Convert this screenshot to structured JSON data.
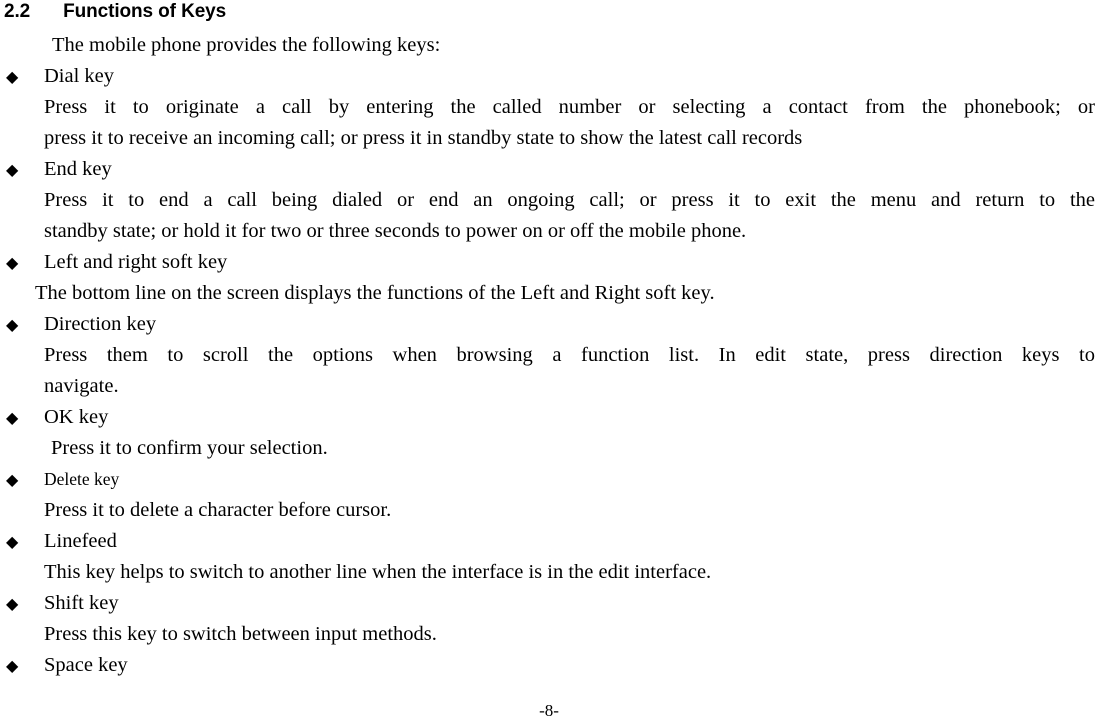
{
  "document": {
    "section_number": "2.2",
    "section_title": "Functions of Keys",
    "intro": "The mobile phone provides the following keys:",
    "bullet_glyph": "◆",
    "page_number": "-8-"
  },
  "items": [
    {
      "label": "Dial key",
      "paragraph_lines": [
        "Press it to originate a call by entering the called number or selecting a contact from the phonebook; or",
        "press it to receive an incoming call; or press it in standby state to show the latest call records"
      ]
    },
    {
      "label": "End key",
      "paragraph_lines": [
        "Press it to end a call being dialed or end an ongoing call; or press it to exit the menu and return to the",
        "standby state; or hold it for two or three seconds to power on or off the mobile phone."
      ]
    },
    {
      "label": "Left and right soft key",
      "paragraph_lines": [
        "The bottom line on the screen displays the functions of the Left and Right soft key."
      ]
    },
    {
      "label": "Direction key",
      "paragraph_lines": [
        "Press them to scroll the options when browsing a function list. In edit state, press direction keys to",
        "navigate."
      ]
    },
    {
      "label": "OK key",
      "paragraph_lines": [
        "Press it to confirm your selection."
      ]
    },
    {
      "label": "Delete key",
      "paragraph_lines": [
        "Press it to delete a character before cursor."
      ]
    },
    {
      "label": "Linefeed",
      "paragraph_lines": [
        "This key helps to switch to another line when the interface is in the edit interface."
      ]
    },
    {
      "label": "Shift key",
      "paragraph_lines": [
        "Press this key to switch between input methods."
      ]
    },
    {
      "label": "Space key",
      "paragraph_lines": []
    }
  ]
}
